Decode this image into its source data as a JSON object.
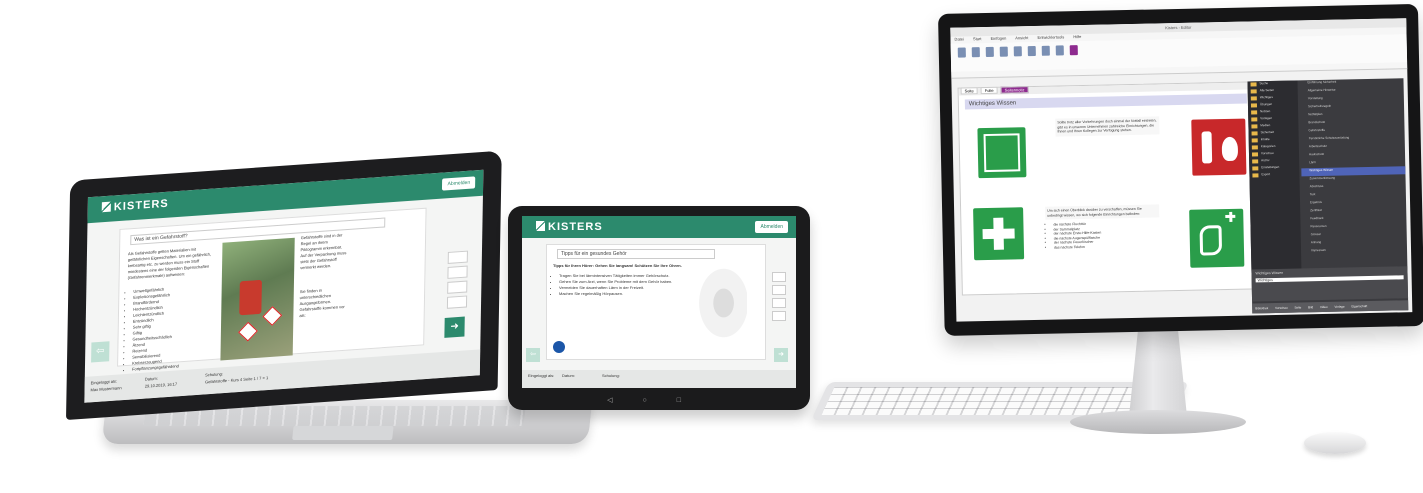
{
  "laptop": {
    "brand": "KISTERS",
    "header_button": "Abmelden",
    "question": "Was ist ein Gefahrstoff?",
    "body_left": "Als Gefahrstoffe gelten Materialien mit gefährlichen Eigenschaften. Um ein gefährlich, krebsartig etc. zu werden muss ein Stoff mindestens eine der folgenden Eigenschaften (Gefahrenmerkmale) aufweisen:",
    "list_items": [
      "Umweltgefährlich",
      "Explosionsgefährlich",
      "Brandfördernd",
      "Hochentzündlich",
      "Leichtentzündlich",
      "Entzündlich",
      "Sehr giftig",
      "Giftig",
      "Gesundheitsschädlich",
      "Ätzend",
      "Reizend",
      "Sensibilisierend",
      "Krebserzeugend",
      "Fortpflanzungsgefährdend",
      "Erbgutverändernd"
    ],
    "body_right": "Gefahrstoffe sind in der Regel an ihrem Piktogramm erkennbar. Auf der Verpackung muss stets der Gefahrstoff vermerkt werden.",
    "body_right_2": "Sie finden in unterschiedlichen Ausgangsformen. Gefahrstoffe kommen vor als:",
    "footer": {
      "label_1": "Eingeloggt als:",
      "value_1": "Max Mustermann",
      "label_2": "Datum:",
      "value_2": "29.10.2019, 16:17",
      "label_3": "Schulung:",
      "value_3": "Gefahrstoffe - Kurs 4 Seite 1 / 7 = 1"
    },
    "next_glyph": "➜",
    "prev_glyph": "⇦"
  },
  "tablet": {
    "brand": "KISTERS",
    "header_button": "Abmelden",
    "question": "Tipps für ein gesundes Gehör",
    "heading": "Tipps für Ihren Hörer: Gehen Sie langsam! Schützen Sie Ihre Ohren.",
    "bullets": [
      "Tragen Sie bei lärmintensiven Tätigkeiten immer Gehörschutz.",
      "Gehen Sie zum Arzt, wenn Sie Probleme mit dem Gehör haben.",
      "Vermeiden Sie dauerhaften Lärm in der Freizeit.",
      "Machen Sie regelmäßig Hörpausen."
    ],
    "footer": {
      "label_1": "Eingeloggt als:",
      "label_2": "Datum:",
      "label_3": "Schulung:"
    },
    "nav": [
      "◁",
      "○",
      "□"
    ]
  },
  "monitor": {
    "title": "Kisters - Editor",
    "ribbon_tabs": [
      "Datei",
      "Start",
      "Einfügen",
      "Ansicht",
      "Entwicklertools",
      "Hilfe"
    ],
    "doc_tabs": [
      "Seite",
      "Folie",
      "Seitennotiz"
    ],
    "doc_title": "Wichtiges Wissen",
    "doc_text_1": "Sollte trotz aller Vorkehrungen doch einmal der Notfall eintreten, gibt es in unserem Unternehmen zahlreiche Einrichtungen, die Ihnen und Ihren Kollegen zur Verfügung stehen.",
    "doc_text_2": "Um sich einen Überblick darüber zu verschaffen, müssen Sie unbedingt wissen, wo sich folgende Einrichtungen befinden:",
    "doc_list": [
      "die nächste Fluchttür",
      "der Sammelplatz",
      "der nächste Erste-Hilfe-Kasten",
      "die nächste Augenspülflasche",
      "der nächste Feuerlöscher",
      "das nächste Telefon"
    ],
    "tree_items": [
      "Suche",
      "Alle Seiten",
      "Wichtiges",
      "Übungen",
      "Notizen",
      "Vorlagen",
      "Medien",
      "Sicherheit",
      "Inhalte",
      "Kategorien",
      "Vorschau",
      "Archiv",
      "Einstellungen",
      "Export"
    ],
    "list_items": [
      "Einführung Sicherheit",
      "Allgemeine Hinweise",
      "Vorstellung",
      "Sicherheitsregeln",
      "Notfallplan",
      "Brandschutz",
      "Gefahrstoffe",
      "Persönliche Schutzausrüstung",
      "Arbeitsschutz",
      "Hautschutz",
      "Lärm",
      "Wichtiges Wissen",
      "Zusammenfassung",
      "Abschluss",
      "Test",
      "Ergebnis",
      "Zertifikat",
      "Feedback",
      "Ressourcen",
      "Glossar",
      "Anhang",
      "Impressum"
    ],
    "highlight_index": 11,
    "prop_title": "Wichtiges Wissen",
    "prop_value": "Wichtiges",
    "status": [
      "Bibliothek",
      "Vorschau",
      "Seite",
      "Bild",
      "Video",
      "Vorlage",
      "Eigenschaft"
    ]
  },
  "colors": {
    "kisters_green": "#2c8a6d",
    "sign_green": "#2a9d4a",
    "sign_red": "#c8282a",
    "highlight": "#4f64b8"
  }
}
